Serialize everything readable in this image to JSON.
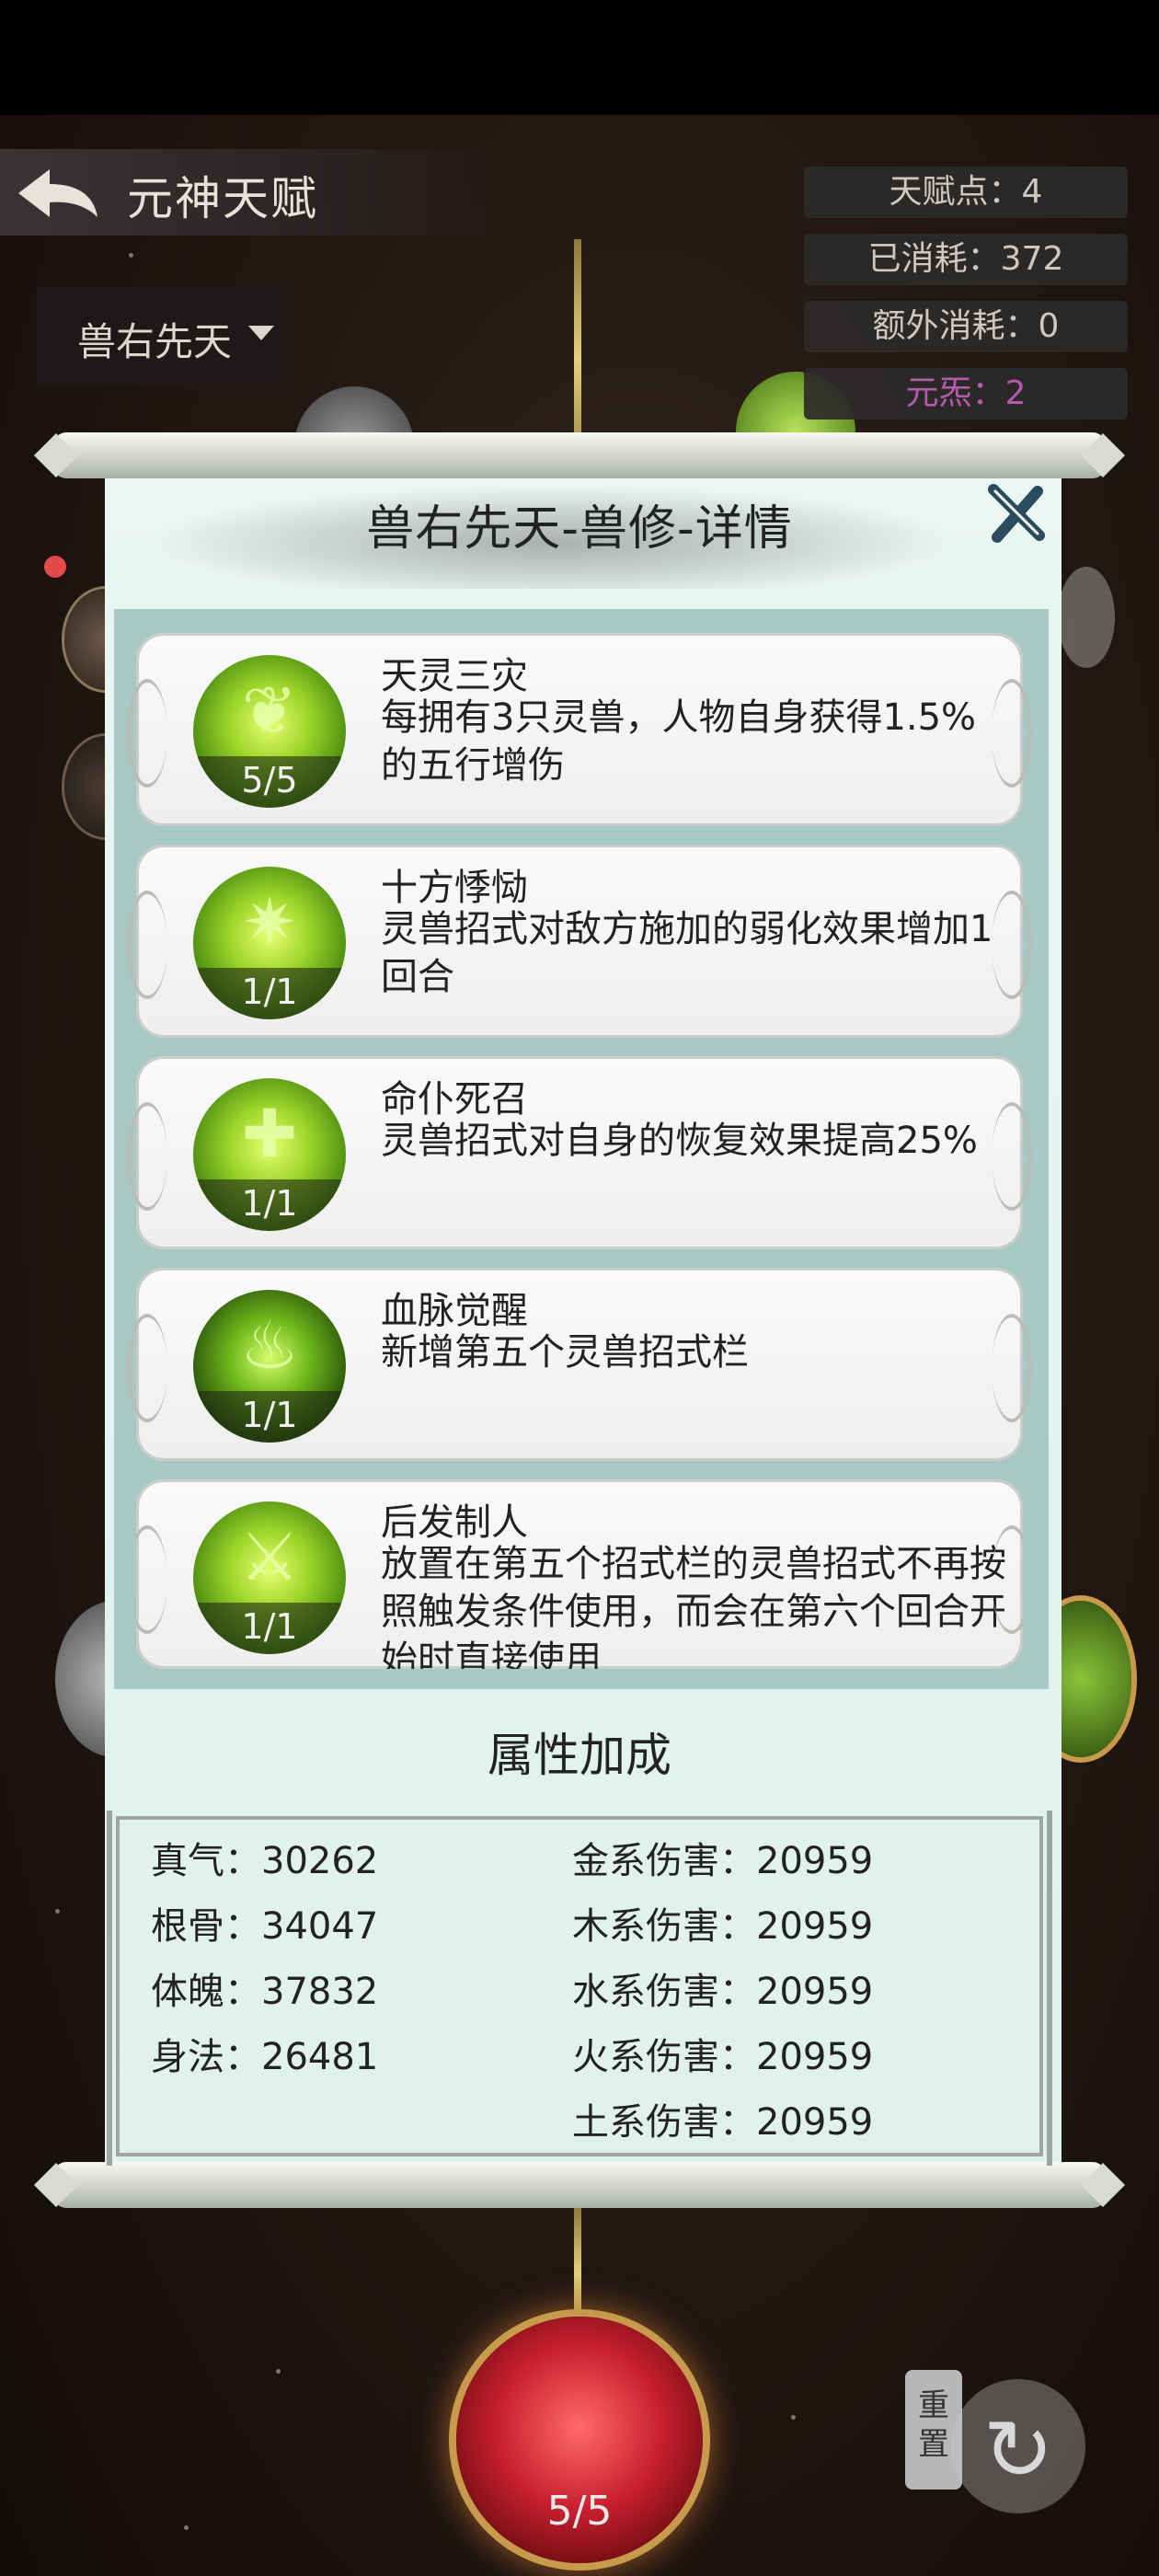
{
  "header": {
    "title": "元神天赋",
    "stats": {
      "talent_points": "天赋点：4",
      "consumed": "已消耗：372",
      "extra_consumed": "额外消耗：0",
      "element": "元炁：2"
    },
    "dropdown_value": "兽右先天"
  },
  "detail_panel": {
    "title": "兽右先天-兽修-详情",
    "skills": [
      {
        "name": "天灵三灾",
        "description": "每拥有3只灵兽，人物自身获得1.5%的五行增伤",
        "level": "5/5"
      },
      {
        "name": "十方悸恸",
        "description": "灵兽招式对敌方施加的弱化效果增加1回合",
        "level": "1/1"
      },
      {
        "name": "命仆死召",
        "description": "灵兽招式对自身的恢复效果提高25%",
        "level": "1/1"
      },
      {
        "name": "血脉觉醒",
        "description": "新增第五个灵兽招式栏",
        "level": "1/1"
      },
      {
        "name": "后发制人",
        "description": "放置在第五个招式栏的灵兽招式不再按照触发条件使用，而会在第六个回合开始时直接使用",
        "level": "1/1"
      }
    ],
    "attributes_title": "属性加成",
    "attributes": {
      "zhenqi": "真气：30262",
      "gengu": "根骨：34047",
      "tipo": "体魄：37832",
      "shenfa": "身法：26481",
      "jin": "金系伤害：20959",
      "mu": "木系伤害：20959",
      "shui": "水系伤害：20959",
      "huo": "火系伤害：20959",
      "tu": "土系伤害：20959"
    }
  },
  "bottom": {
    "node_level": "5/5",
    "reset_label": "重置"
  },
  "colors": {
    "element_text": "#b45bb0",
    "panel_bg": "#e4f4f0",
    "skill_icon_green": "#9ed62a",
    "bottom_node_red": "#c81f2e"
  }
}
